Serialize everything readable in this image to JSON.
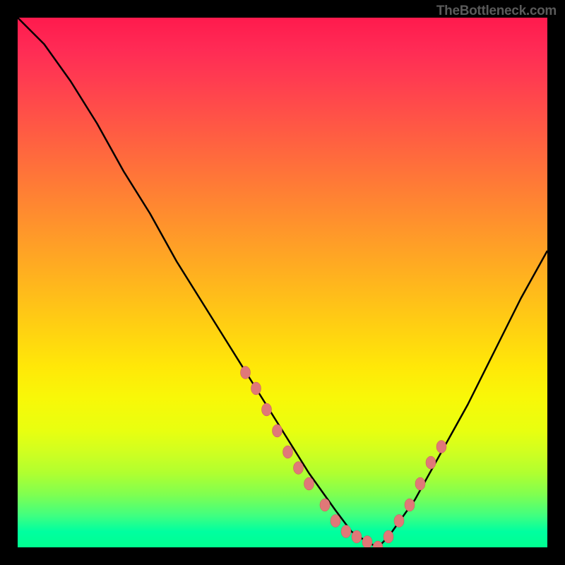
{
  "watermark": "TheBottleneck.com",
  "colors": {
    "background": "#000000",
    "curve_stroke": "#000000",
    "marker_fill": "#E07878",
    "marker_stroke": "#C85858",
    "gradient_top": "#ff1a4d",
    "gradient_bottom": "#00ff90"
  },
  "chart_data": {
    "type": "line",
    "title": "",
    "xlabel": "",
    "ylabel": "",
    "xlim": [
      0,
      100
    ],
    "ylim": [
      0,
      100
    ],
    "description": "V-shaped bottleneck curve with colored gradient background (red=bad at top, green=good at bottom). The curve minimum sits around x≈60-68 at y≈0-2; salmon-colored markers cluster along the descending and ascending legs near the bottom.",
    "series": [
      {
        "name": "bottleneck-curve",
        "x": [
          0,
          5,
          10,
          15,
          20,
          25,
          30,
          35,
          40,
          45,
          50,
          55,
          60,
          63,
          66,
          68,
          70,
          75,
          80,
          85,
          90,
          95,
          100
        ],
        "y": [
          100,
          95,
          88,
          80,
          71,
          63,
          54,
          46,
          38,
          30,
          22,
          14,
          7,
          3,
          1,
          0,
          2,
          9,
          18,
          27,
          37,
          47,
          56
        ]
      }
    ],
    "markers": {
      "name": "data-points",
      "x": [
        43,
        45,
        47,
        49,
        51,
        53,
        55,
        58,
        60,
        62,
        64,
        66,
        68,
        70,
        72,
        74,
        76,
        78,
        80
      ],
      "y": [
        33,
        30,
        26,
        22,
        18,
        15,
        12,
        8,
        5,
        3,
        2,
        1,
        0,
        2,
        5,
        8,
        12,
        16,
        19
      ]
    }
  }
}
